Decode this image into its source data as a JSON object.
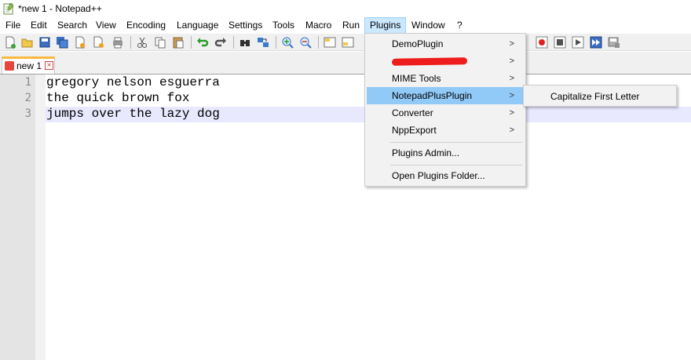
{
  "window": {
    "title": "*new 1 - Notepad++"
  },
  "menubar": {
    "items": [
      "File",
      "Edit",
      "Search",
      "View",
      "Encoding",
      "Language",
      "Settings",
      "Tools",
      "Macro",
      "Run",
      "Plugins",
      "Window",
      "?"
    ],
    "active": "Plugins"
  },
  "toolbar": {
    "icons": [
      "new-file-icon",
      "open-file-icon",
      "save-icon",
      "save-all-icon",
      "close-icon",
      "close-all-icon",
      "print-icon",
      "cut-icon",
      "copy-icon",
      "paste-icon",
      "undo-icon",
      "redo-icon",
      "find-icon",
      "replace-icon",
      "zoom-in-icon",
      "zoom-out-icon",
      "sync-v-icon",
      "sync-h-icon",
      "record-macro-icon",
      "stop-macro-icon",
      "play-macro-icon",
      "run-multiple-macro-icon",
      "save-macro-icon"
    ]
  },
  "tabs": [
    {
      "label": "new 1",
      "active": true
    }
  ],
  "editor": {
    "line_numbers": [
      "1",
      "2",
      "3"
    ],
    "lines": [
      "gregory nelson esguerra",
      "the quick brown fox",
      "jumps over the lazy dog"
    ],
    "current_line": 3
  },
  "plugins_menu": {
    "items": {
      "demo_plugin": "DemoPlugin",
      "mime_tools": "MIME Tools",
      "notepadplusplugin": "NotepadPlusPlugin",
      "converter": "Converter",
      "nppexport": "NppExport",
      "plugins_admin": "Plugins Admin...",
      "open_plugins_folder": "Open Plugins Folder..."
    },
    "highlighted": "NotepadPlusPlugin",
    "submenu_arrow": ">"
  },
  "submenu": {
    "items": [
      "Capitalize First Letter"
    ]
  },
  "colors": {
    "menu_active_bg": "#cce8ff",
    "menu_hover_bg": "#91c9f7",
    "current_line_bg": "#e8e8ff",
    "gutter_bg": "#e4e4e4",
    "tab_accent": "#fab93c",
    "redaction": "#ee1c1c"
  }
}
